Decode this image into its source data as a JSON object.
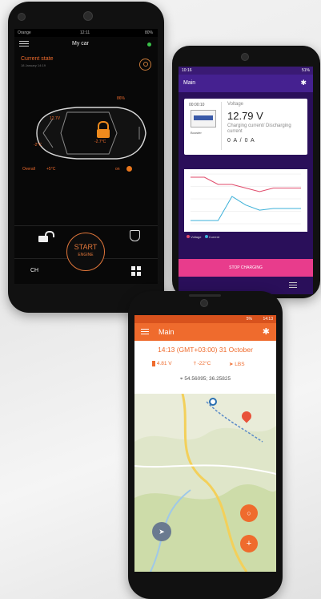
{
  "phone1": {
    "status": {
      "carrier": "Orange",
      "time": "12:11",
      "battery": "80%"
    },
    "header": {
      "title": "My car"
    },
    "state": {
      "title": "Current state",
      "date": "18 January 14:19"
    },
    "car": {
      "top_temp": "12.7V",
      "side_temp": "-2°C",
      "engine_temp": "-2.7°C",
      "fuel": "86%"
    },
    "indicators": {
      "left": "Overall",
      "middle": "+5°C",
      "right": "on"
    },
    "controls": {
      "start_line1": "START",
      "start_line2": "ENGINE",
      "ch_label": "CH"
    }
  },
  "phone2": {
    "status": {
      "time": "10:16",
      "battery": "51%"
    },
    "header": {
      "title": "Main"
    },
    "card": {
      "timer": "00:00:10",
      "device_label": "Booster",
      "voltage_label": "Voltage",
      "voltage": "12.79 V",
      "current_label": "Charging current/ Discharging current",
      "current": "0 A / 0 A"
    },
    "chart_data": {
      "type": "line",
      "x": [
        0,
        1,
        2,
        3,
        4,
        5,
        6,
        7,
        8
      ],
      "series": [
        {
          "name": "Voltage",
          "values": [
            12.9,
            12.9,
            12.8,
            12.8,
            12.75,
            12.7,
            12.75,
            12.75,
            12.75
          ]
        },
        {
          "name": "Current",
          "values": [
            0,
            0,
            0,
            2.8,
            1.8,
            1.2,
            1.4,
            1.4,
            1.4
          ]
        }
      ],
      "legend": "bottom-left"
    },
    "stop_button": "STOP CHARGING"
  },
  "phone3": {
    "status": {
      "battery": "5%",
      "time": "14:13"
    },
    "header": {
      "title": "Main"
    },
    "datetime": "14:13 (GMT+03:00) 31 October",
    "stats": {
      "voltage": "4.81 V",
      "temperature": "-22°C",
      "signal": "LBS"
    },
    "coords": "54.56095; 36.25825",
    "colors": {
      "accent": "#ef6b2d"
    }
  }
}
